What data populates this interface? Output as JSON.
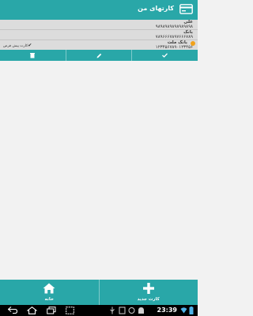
{
  "app_bar": {
    "title": "کارتهای من",
    "icon": "credit-card-icon"
  },
  "cards": [
    {
      "name": "علی",
      "number": "۹۸۹۸۹۸۹۸۹۸۹۸۹۸۹۸"
    },
    {
      "name": "بانک",
      "number": "۷۸۹۶۶۶۷۸۹۷۶۶۶۷۸۹"
    },
    {
      "name": "بانک ملت",
      "number": "۱۲۳۴۵۶۷۸۹۰۱۲۳۴۵۶",
      "default_label": "کارت پیش فرض",
      "is_default": true
    }
  ],
  "actions": [
    {
      "icon": "delete-icon"
    },
    {
      "icon": "edit-icon"
    },
    {
      "icon": "check-icon"
    }
  ],
  "bottom_nav": {
    "home_label": "خانه",
    "new_card_label": "کارت جدید"
  },
  "system_bar": {
    "time": "23:39"
  },
  "colors": {
    "primary": "#29a7a8",
    "card_bg": "#dcdcdc",
    "accent": "#f1a21b"
  }
}
